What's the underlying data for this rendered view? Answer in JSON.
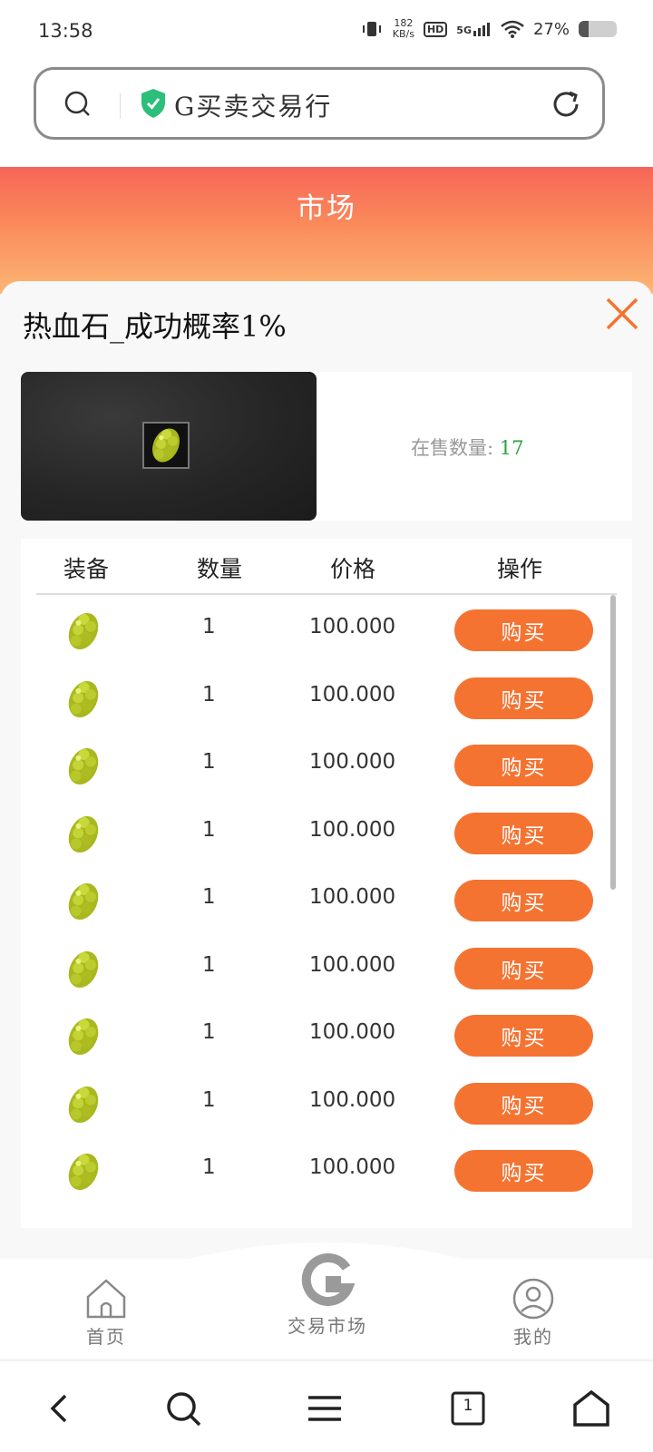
{
  "status": {
    "time": "13:58",
    "net_speed_value": "182",
    "net_speed_unit": "KB/s",
    "hd": "HD",
    "signal": "5G",
    "battery": "27%",
    "battery_level": 0.27
  },
  "browser": {
    "url_text": "G买卖交易行"
  },
  "header": {
    "title": "市场"
  },
  "modal": {
    "title": "热血石_成功概率1%",
    "stock_label": "在售数量:",
    "stock_value": "17"
  },
  "table": {
    "headers": {
      "item": "装备",
      "qty": "数量",
      "price": "价格",
      "action": "操作"
    },
    "rows": [
      {
        "qty": "1",
        "price": "100.000",
        "action": "购买"
      },
      {
        "qty": "1",
        "price": "100.000",
        "action": "购买"
      },
      {
        "qty": "1",
        "price": "100.000",
        "action": "购买"
      },
      {
        "qty": "1",
        "price": "100.000",
        "action": "购买"
      },
      {
        "qty": "1",
        "price": "100.000",
        "action": "购买"
      },
      {
        "qty": "1",
        "price": "100.000",
        "action": "购买"
      },
      {
        "qty": "1",
        "price": "100.000",
        "action": "购买"
      },
      {
        "qty": "1",
        "price": "100.000",
        "action": "购买"
      },
      {
        "qty": "1",
        "price": "100.000",
        "action": "购买"
      }
    ]
  },
  "app_nav": {
    "home": "首页",
    "market": "交易市场",
    "mine": "我的"
  },
  "system_nav": {
    "tab_count": "1"
  },
  "colors": {
    "accent": "#f57331",
    "stock_green": "#2aa33a"
  }
}
